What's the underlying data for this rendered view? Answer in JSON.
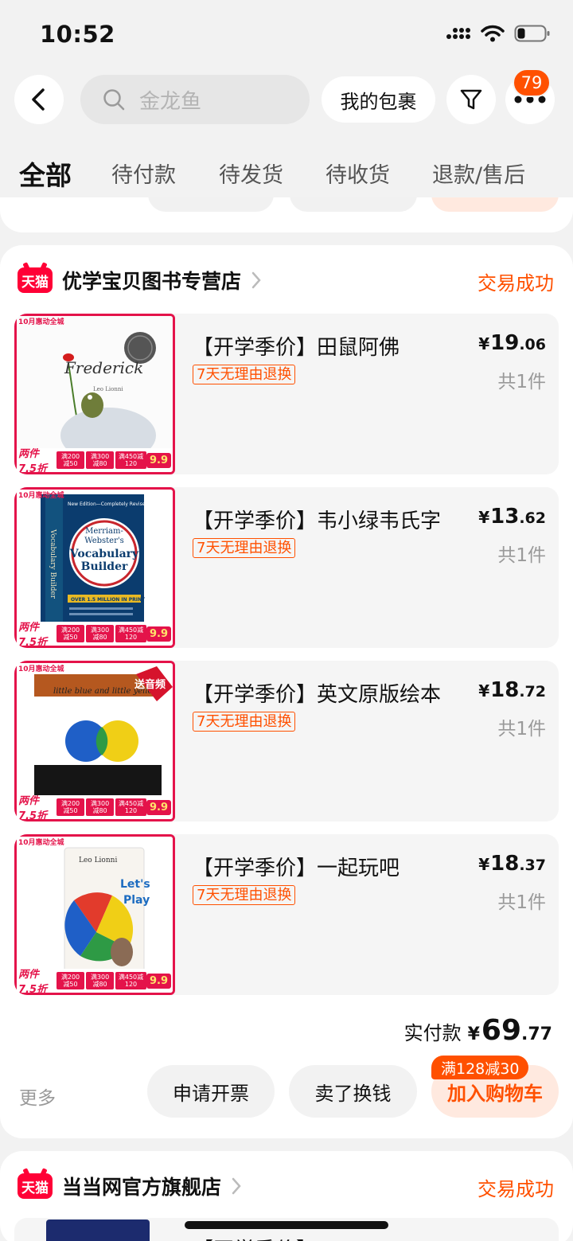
{
  "status_bar": {
    "time": "10:52"
  },
  "header": {
    "search_placeholder": "金龙鱼",
    "package_button": "我的包裹",
    "message_badge": "79"
  },
  "tabs": [
    {
      "label": "全部",
      "active": true
    },
    {
      "label": "待付款"
    },
    {
      "label": "待发货"
    },
    {
      "label": "待收货"
    },
    {
      "label": "退款/售后"
    }
  ],
  "order": {
    "store_badge": "天猫",
    "store_name": "优学宝贝图书专营店",
    "status": "交易成功",
    "items": [
      {
        "title": "【开学季价】田鼠阿佛",
        "tag": "7天无理由退换",
        "price_int": "19",
        "price_dec": ".06",
        "qty": "共1件",
        "cover": {
          "title": "Frederick",
          "author": "Leo Lionni"
        }
      },
      {
        "title": "【开学季价】韦小绿韦氏字",
        "tag": "7天无理由退换",
        "price_int": "13",
        "price_dec": ".62",
        "qty": "共1件",
        "cover": {
          "edition": "New Edition—Completely Revised!",
          "title_1": "Merriam-",
          "title_2": "Webster's",
          "title_3": "Vocabulary",
          "title_4": "Builder",
          "spine": "Vocabulary Builder",
          "note": "OVER 1.5 MILLION IN PRINT"
        }
      },
      {
        "title": "【开学季价】英文原版绘本",
        "tag": "7天无理由退换",
        "price_int": "18",
        "price_dec": ".72",
        "qty": "共1件",
        "cover": {
          "title": "little blue and little yellow",
          "sticker": "送音频"
        }
      },
      {
        "title": "【开学季价】一起玩吧",
        "tag": "7天无理由退换",
        "price_int": "18",
        "price_dec": ".37",
        "qty": "共1件",
        "cover": {
          "author": "Leo Lionni",
          "title_1": "Let's",
          "title_2": "Play"
        }
      }
    ],
    "promo_strip": {
      "two_items": "两件7.5折",
      "coupons": [
        "满200减50",
        "满300减80",
        "满450减120"
      ],
      "deal": "9.9"
    },
    "total_label": "实付款",
    "total_int": "69",
    "total_dec": ".77",
    "more_label": "更多",
    "invoice_button": "申请开票",
    "sell_button": "卖了换钱",
    "cart_button": "加入购物车",
    "cart_promo": "满128减30"
  },
  "next_order": {
    "store_badge": "天猫",
    "store_name": "当当网官方旗舰店",
    "status": "交易成功",
    "item_title": "【开学季价】"
  },
  "colors": {
    "accent": "#ff5000",
    "tmall_red": "#ff0036",
    "promo_red": "#e4134a"
  }
}
